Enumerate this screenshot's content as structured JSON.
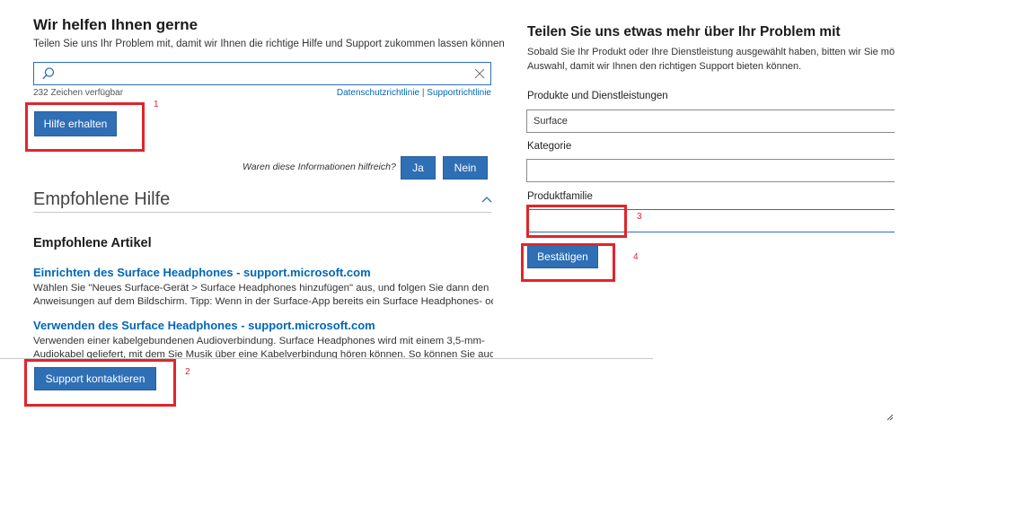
{
  "left": {
    "title": "Wir helfen Ihnen gerne",
    "subtitle": "Teilen Sie uns Ihr Problem mit, damit wir Ihnen die richtige Hilfe und Support zukommen lassen können",
    "search": {
      "value": "",
      "placeholder": ""
    },
    "char_count": "232 Zeichen verfügbar",
    "privacy_link": "Datenschutzrichtlinie",
    "separator": "|",
    "support_policy_link": "Supportrichtlinie",
    "get_help_button": "Hilfe erhalten",
    "feedback_question": "Waren diese Informationen hilfreich?",
    "yes_button": "Ja",
    "no_button": "Nein",
    "recommended_help_heading": "Empfohlene Hilfe",
    "recommended_articles_heading": "Empfohlene Artikel",
    "articles": [
      {
        "title": "Einrichten des Surface Headphones - support.microsoft.com",
        "line1": "Wählen Sie \"Neues Surface-Gerät > Surface Headphones hinzufügen\" aus, und folgen Sie dann den",
        "line2": "Anweisungen auf dem Bildschirm. Tipp: Wenn in der Surface-App bereits ein Surface Headphones- oder"
      },
      {
        "title": "Verwenden des Surface Headphones - support.microsoft.com",
        "line1": "Verwenden einer kabelgebundenen Audioverbindung. Surface Headphones wird mit einem 3,5-mm-",
        "line2": "Audiokabel geliefert, mit dem Sie Musik über eine Kabelverbindung hören können. So können Sie auch"
      }
    ],
    "contact_support_button": "Support kontaktieren"
  },
  "right": {
    "title": "Teilen Sie uns etwas mehr über Ihr Problem mit",
    "desc_line1": "Sobald Sie Ihr Produkt oder Ihre Dienstleistung ausgewählt haben, bitten wir Sie mö",
    "desc_line2": "Auswahl, damit wir Ihnen den richtigen Support bieten können.",
    "products_label": "Produkte und Dienstleistungen",
    "products_value": "Surface",
    "category_label": "Kategorie",
    "category_value": "",
    "family_label": "Produktfamilie",
    "family_value": "",
    "confirm_button": "Bestätigen"
  },
  "annotations": {
    "n1": "1",
    "n2": "2",
    "n3": "3",
    "n4": "4"
  },
  "colors": {
    "accent": "#2f6fb5",
    "link": "#0067b8",
    "annotation": "#e0252b"
  }
}
